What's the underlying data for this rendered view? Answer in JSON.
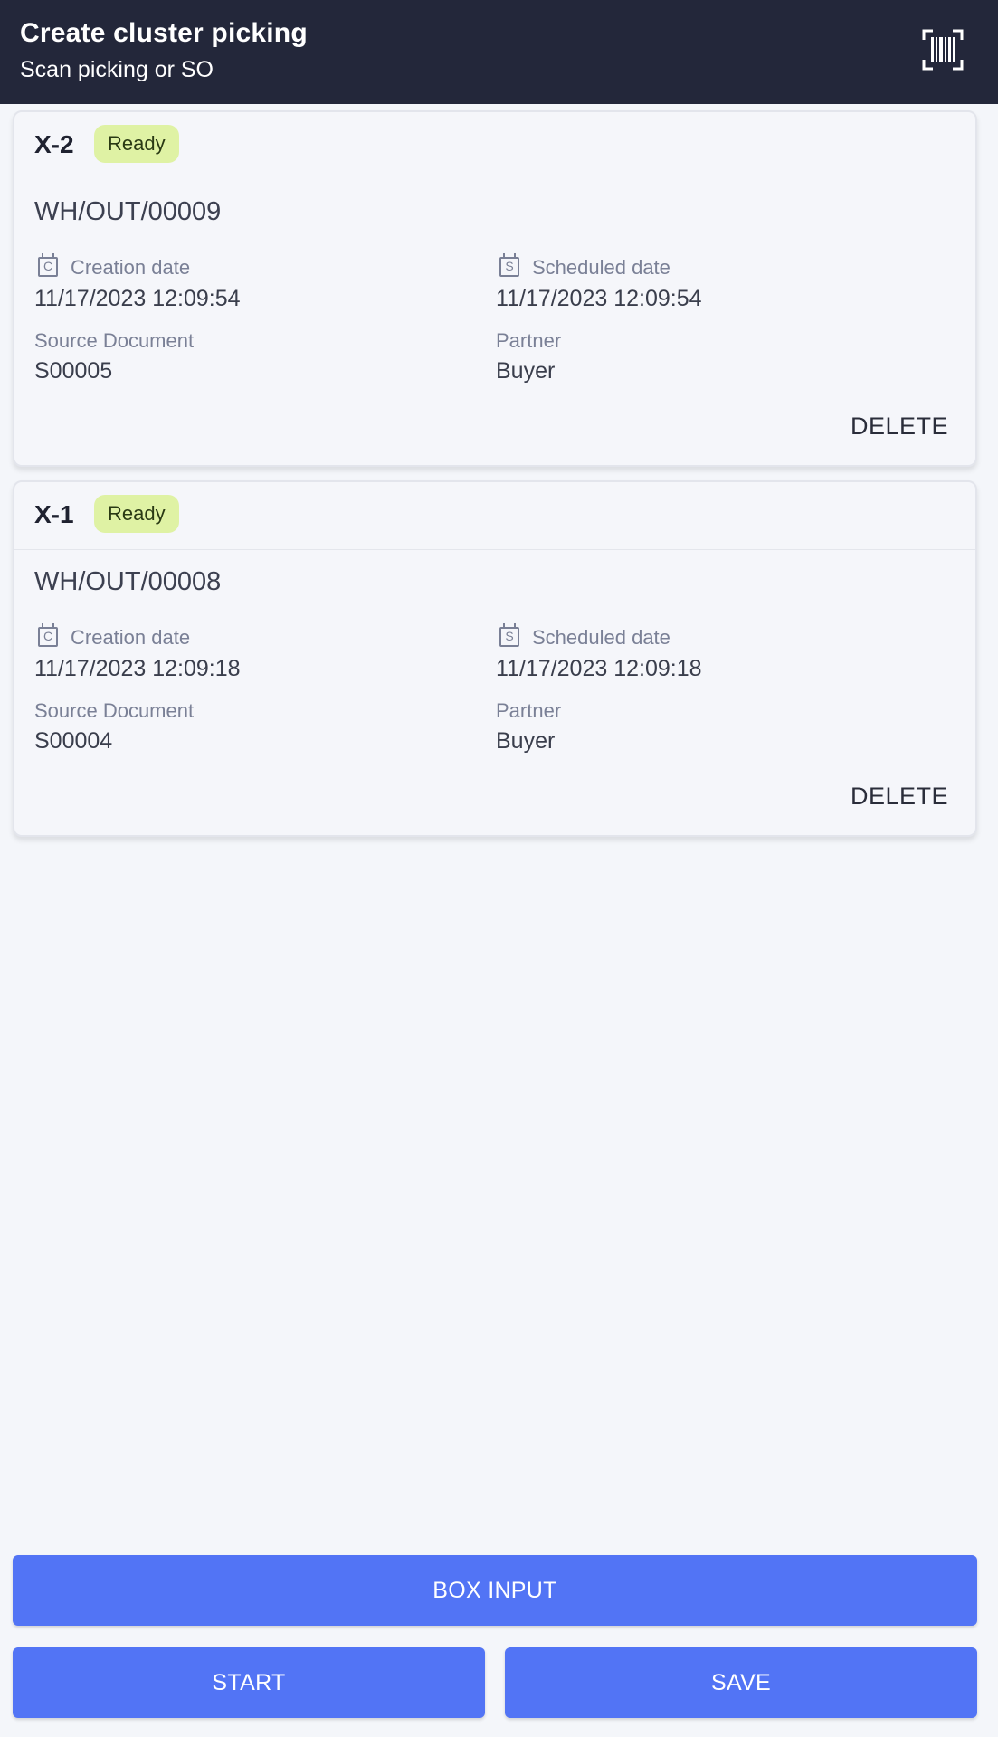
{
  "header": {
    "title": "Create cluster picking",
    "subtitle": "Scan picking or SO",
    "scan_icon": "barcode-scan-icon"
  },
  "pickings": [
    {
      "code": "X-2",
      "status": "Ready",
      "reference": "WH/OUT/00009",
      "creation_label": "Creation date",
      "creation_icon_letter": "C",
      "creation_date": "11/17/2023 12:09:54",
      "scheduled_label": "Scheduled date",
      "scheduled_icon_letter": "S",
      "scheduled_date": "11/17/2023 12:09:54",
      "source_label": "Source Document",
      "source": "S00005",
      "partner_label": "Partner",
      "partner": "Buyer",
      "delete_label": "DELETE"
    },
    {
      "code": "X-1",
      "status": "Ready",
      "reference": "WH/OUT/00008",
      "creation_label": "Creation date",
      "creation_icon_letter": "C",
      "creation_date": "11/17/2023 12:09:18",
      "scheduled_label": "Scheduled date",
      "scheduled_icon_letter": "S",
      "scheduled_date": "11/17/2023 12:09:18",
      "source_label": "Source Document",
      "source": "S00004",
      "partner_label": "Partner",
      "partner": "Buyer",
      "delete_label": "DELETE"
    }
  ],
  "actions": {
    "box_input": "BOX INPUT",
    "start": "START",
    "save": "SAVE"
  },
  "colors": {
    "appbar": "#23273a",
    "badge_ready": "#dff2a4",
    "primary_button": "#5274f5"
  }
}
